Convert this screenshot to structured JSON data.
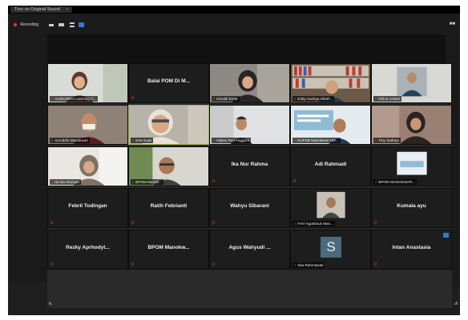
{
  "sound_tab": {
    "label": "Turn on Original Sound",
    "close": "×"
  },
  "toolbar": {
    "recording_label": "Recording"
  },
  "participants": [
    {
      "id": "p1",
      "label": "AUDIOBRO Learning C...",
      "type": "video",
      "scene": "woman-hijab-light"
    },
    {
      "id": "p2",
      "name": "Balai POM Di M...",
      "type": "name"
    },
    {
      "id": "p3",
      "label": "Dinaldi Erma",
      "type": "video",
      "scene": "woman-hijab-dark"
    },
    {
      "id": "p4",
      "label": "Eddy Sanitya Abrah...",
      "type": "video",
      "scene": "bookshelf"
    },
    {
      "id": "p5",
      "label": "Dhina Lestari",
      "type": "video",
      "scene": "man-small"
    },
    {
      "id": "p6",
      "label": "Acruddin Manokwari",
      "type": "video",
      "scene": "man-mask"
    },
    {
      "id": "p7",
      "label": "Erta Iloeb",
      "type": "video",
      "scene": "woman-glasses",
      "active": true
    },
    {
      "id": "p8",
      "label": "Rijkan Reo Anggoro",
      "type": "video",
      "scene": "man-cap"
    },
    {
      "id": "p9",
      "label": "KUPSB Manokwari Her...",
      "type": "video",
      "scene": "man-banner"
    },
    {
      "id": "p10",
      "label": "Tiny Sadriya",
      "type": "video",
      "scene": "woman-hijab-pink"
    },
    {
      "id": "p11",
      "label": "Ita tan Afuriyan",
      "type": "video",
      "scene": "woman-hijab-grey"
    },
    {
      "id": "p12",
      "label": "BPOM Manok...",
      "type": "video",
      "scene": "man-glasses"
    },
    {
      "id": "p13",
      "name": "Ika Nur Rahma",
      "type": "name"
    },
    {
      "id": "p14",
      "name": "Adi Rahmadi",
      "type": "name"
    },
    {
      "id": "p15",
      "label": "BPOM MANOKWAR...",
      "type": "video",
      "scene": "screen-small"
    },
    {
      "id": "p16",
      "name": "Febril Todingan",
      "type": "name"
    },
    {
      "id": "p17",
      "name": "Ratih Febrianti",
      "type": "name"
    },
    {
      "id": "p18",
      "name": "Wahyu Sibarani",
      "type": "name"
    },
    {
      "id": "p19",
      "label": "Ferri Agustinus Man...",
      "type": "video",
      "scene": "man-small-2"
    },
    {
      "id": "p20",
      "name": "Kumala ayu",
      "type": "name"
    },
    {
      "id": "p21",
      "name": "Rezky  Aprhodyt...",
      "type": "name"
    },
    {
      "id": "p22",
      "name": "BPOM  Manokw...",
      "type": "name"
    },
    {
      "id": "p23",
      "name": "Agus  Wahyudi ...",
      "type": "name"
    },
    {
      "id": "p24",
      "label": "Sita Rahmawati",
      "avatar_letter": "S",
      "type": "avatar"
    },
    {
      "id": "p25",
      "name": "Intan Anastasia",
      "type": "name"
    }
  ],
  "icons": {
    "mic_muted": "mic-muted-icon",
    "view": "gallery-view-icon"
  },
  "colors": {
    "mic_muted": "#e53935",
    "active_speaker": "#9fb34a",
    "avatar_bg": "#4a6b7c",
    "badge": "#2f7ad6"
  }
}
